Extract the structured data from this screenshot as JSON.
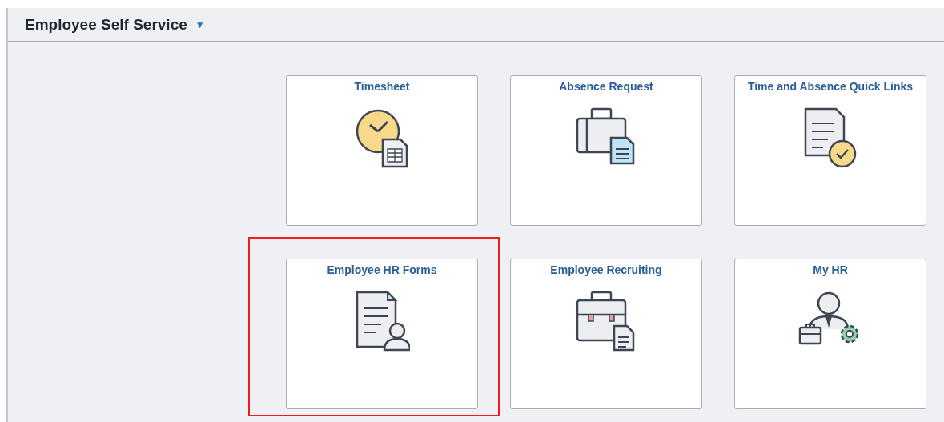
{
  "header": {
    "title": "Employee Self Service",
    "menu_caret": "▼"
  },
  "tiles": [
    {
      "title": "Timesheet",
      "highlighted": false
    },
    {
      "title": "Absence Request",
      "highlighted": false
    },
    {
      "title": "Time and Absence Quick Links",
      "highlighted": false
    },
    {
      "title": "Employee HR Forms",
      "highlighted": true
    },
    {
      "title": "Employee Recruiting",
      "highlighted": false
    },
    {
      "title": "My HR",
      "highlighted": false
    }
  ]
}
